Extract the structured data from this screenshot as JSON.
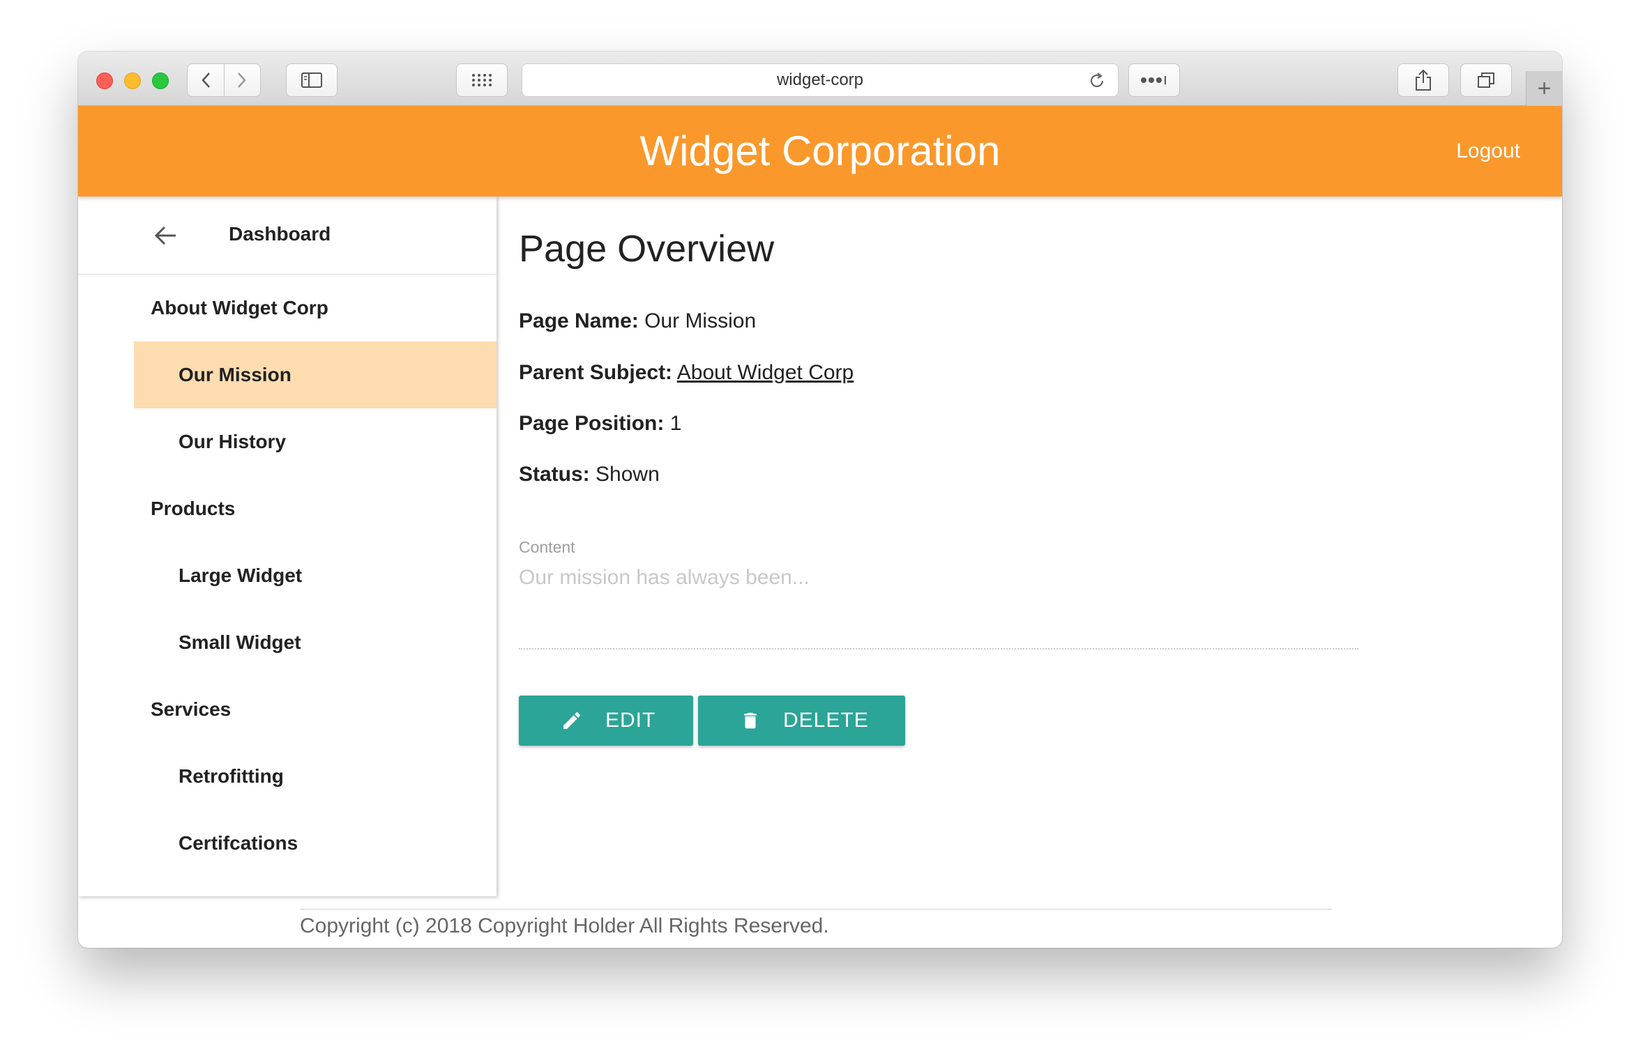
{
  "browser": {
    "address": "widget-corp",
    "new_tab_symbol": "+"
  },
  "header": {
    "title": "Widget Corporation",
    "logout_label": "Logout",
    "color": "#fb982b"
  },
  "sidebar": {
    "dashboard_label": "Dashboard",
    "items": [
      {
        "label": "About Widget Corp",
        "level": "top",
        "active": false
      },
      {
        "label": "Our Mission",
        "level": "sub",
        "active": true
      },
      {
        "label": "Our History",
        "level": "sub",
        "active": false
      },
      {
        "label": "Products",
        "level": "top",
        "active": false
      },
      {
        "label": "Large Widget",
        "level": "sub",
        "active": false
      },
      {
        "label": "Small Widget",
        "level": "sub",
        "active": false
      },
      {
        "label": "Services",
        "level": "top",
        "active": false
      },
      {
        "label": "Retrofitting",
        "level": "sub",
        "active": false
      },
      {
        "label": "Certifcations",
        "level": "sub",
        "active": false
      }
    ],
    "active_color": "#fddcb0"
  },
  "main": {
    "title": "Page Overview",
    "page_name_label": "Page Name:",
    "page_name_value": "Our Mission",
    "parent_subject_label": "Parent Subject:",
    "parent_subject_value": "About Widget Corp",
    "page_position_label": "Page Position:",
    "page_position_value": "1",
    "status_label": "Status:",
    "status_value": "Shown",
    "content_label": "Content",
    "content_placeholder": "Our mission has always been...",
    "edit_label": "EDIT",
    "delete_label": "DELETE",
    "button_color": "#2ba597"
  },
  "footer": {
    "text": "Copyright (c) 2018 Copyright Holder All Rights Reserved."
  }
}
